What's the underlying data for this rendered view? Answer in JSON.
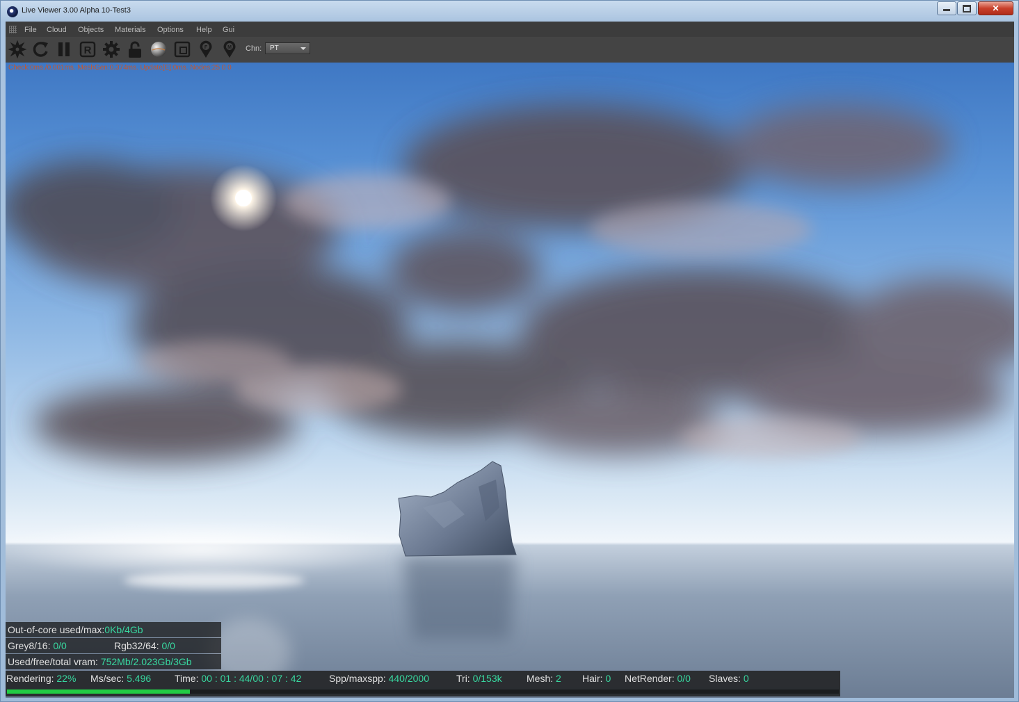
{
  "window": {
    "title": "Live Viewer 3.00 Alpha 10-Test3"
  },
  "menu": [
    "File",
    "Cloud",
    "Objects",
    "Materials",
    "Options",
    "Help",
    "Gui"
  ],
  "toolbar": {
    "icons": [
      "aperture-icon",
      "refresh-icon",
      "pause-icon",
      "r-icon",
      "gear-icon",
      "lock-icon",
      "sphere-icon",
      "region-icon",
      "pin-f-icon",
      "pin-m-icon"
    ],
    "channel_label": "Chn:",
    "channel_value": "PT"
  },
  "stats_line": "Check:0ms./0.001ms. MeshGen:0.374ms. Update[E]:0ms. Nodes:25  0 0",
  "memory": {
    "out_of_core_label": "Out-of-core used/max:",
    "out_of_core_value": "0Kb/4Gb",
    "grey_label": "Grey8/16: ",
    "grey_value": "0/0",
    "rgb_label": "Rgb32/64: ",
    "rgb_value": "0/0",
    "vram_label": "Used/free/total vram: ",
    "vram_value": "752Mb/2.023Gb/3Gb"
  },
  "status": {
    "rendering_label": "Rendering: ",
    "rendering_value": "22%",
    "progress": 0.22,
    "ms_label": "Ms/sec: ",
    "ms_value": "5.496",
    "time_label": "Time: ",
    "time_value": "00 : 01 : 44/00 : 07 : 42",
    "spp_label": "Spp/maxspp: ",
    "spp_value": "440/2000",
    "tri_label": "Tri: ",
    "tri_value": "0/153k",
    "mesh_label": "Mesh: ",
    "mesh_value": "2",
    "hair_label": "Hair: ",
    "hair_value": "0",
    "netrender_label": "NetRender: ",
    "netrender_value": "0/0",
    "slaves_label": "Slaves: ",
    "slaves_value": "0"
  },
  "colors": {
    "accent_value": "#38d8a0",
    "progress": "#22cc44",
    "stats_text": "#c4572f"
  }
}
